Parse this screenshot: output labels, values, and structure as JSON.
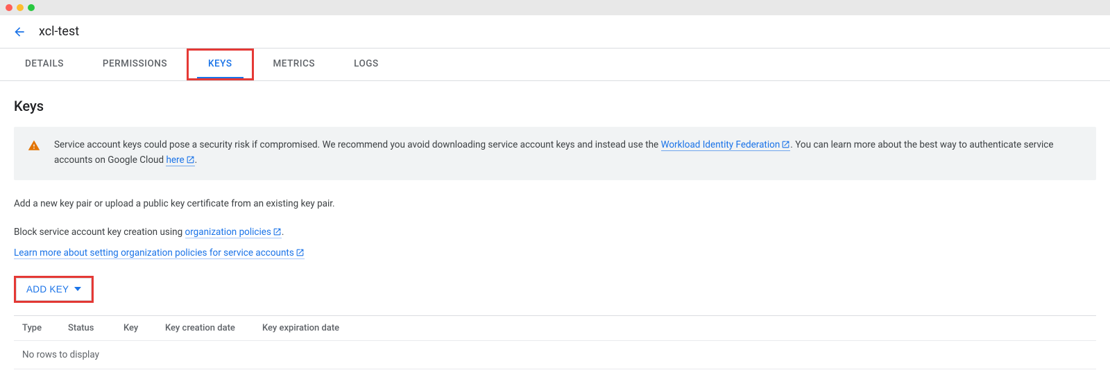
{
  "header": {
    "title": "xcl-test"
  },
  "tabs": {
    "details": "DETAILS",
    "permissions": "PERMISSIONS",
    "keys": "KEYS",
    "metrics": "METRICS",
    "logs": "LOGS",
    "active": "keys"
  },
  "page": {
    "title": "Keys"
  },
  "infobox": {
    "text_before_link1": "Service account keys could pose a security risk if compromised. We recommend you avoid downloading service account keys and instead use the ",
    "link1": "Workload Identity Federation",
    "text_mid": ". You can learn more about the best way to authenticate service accounts on Google Cloud ",
    "link2": "here",
    "text_after": "."
  },
  "instructions": {
    "add_desc": "Add a new key pair or upload a public key certificate from an existing key pair.",
    "block_prefix": "Block service account key creation using ",
    "org_policies": "organization policies",
    "block_suffix": ".",
    "learn_more": "Learn more about setting organization policies for service accounts"
  },
  "buttons": {
    "add_key": "ADD KEY"
  },
  "table": {
    "headers": {
      "type": "Type",
      "status": "Status",
      "key": "Key",
      "creation": "Key creation date",
      "expiration": "Key expiration date"
    },
    "empty": "No rows to display"
  }
}
